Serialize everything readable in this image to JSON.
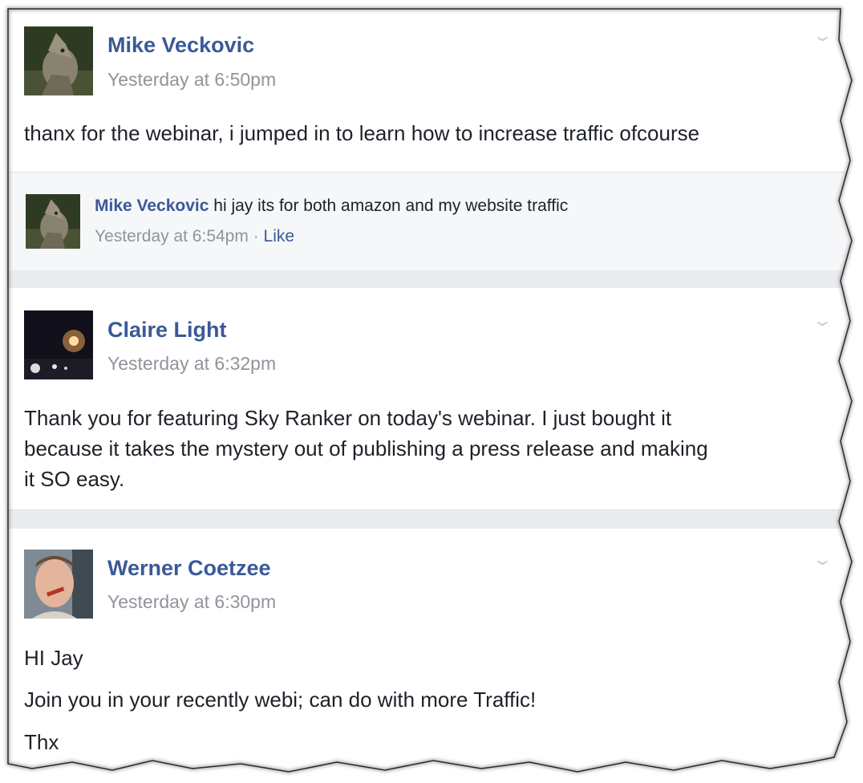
{
  "posts": [
    {
      "author": "Mike Veckovic",
      "timestamp": "Yesterday at 6:50pm",
      "lines": [
        "thanx for the webinar, i jumped in to learn how to increase traffic ofcourse"
      ],
      "reply": {
        "author": "Mike Veckovic",
        "text": " hi jay its for both amazon and my website traffic",
        "timestamp": "Yesterday at 6:54pm",
        "separator": " · ",
        "like_label": "Like"
      }
    },
    {
      "author": "Claire Light",
      "timestamp": "Yesterday at 6:32pm",
      "lines": [
        "Thank you for featuring Sky Ranker on today's webinar. I just bought it",
        "because it takes the mystery out of publishing a press release and making",
        "it SO easy."
      ]
    },
    {
      "author": "Werner Coetzee",
      "timestamp": "Yesterday at 6:30pm",
      "lines": [
        "HI Jay",
        "Join you in your recently webi; can do with more Traffic!",
        "Thx"
      ]
    }
  ],
  "icons": {
    "post_menu": "chevron-down-icon"
  },
  "colors": {
    "link": "#3b5998",
    "meta": "#90949c",
    "text": "#1d2129",
    "reply_bg": "#f6f7f9",
    "separator": "#e9ebee"
  }
}
